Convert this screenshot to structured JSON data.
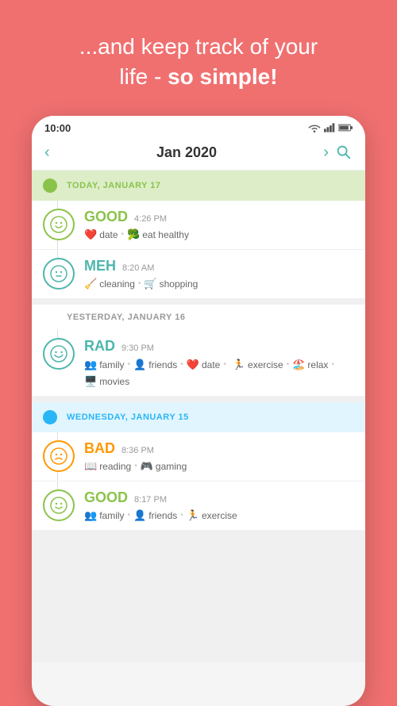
{
  "header": {
    "line1": "...and keep track of your",
    "line2_plain": "life - ",
    "line2_bold": "so simple!"
  },
  "statusBar": {
    "time": "10:00",
    "icons": [
      "wifi",
      "signal",
      "battery"
    ]
  },
  "nav": {
    "title": "Jan 2020",
    "leftArrow": "‹",
    "rightArrow": "›",
    "searchIcon": "search"
  },
  "days": [
    {
      "id": "today",
      "type": "today",
      "label": "TODAY, JANUARY 17",
      "dotColor": "green",
      "entries": [
        {
          "mood": "GOOD",
          "moodColor": "green",
          "time": "4:26 PM",
          "face": "😊",
          "tags": [
            {
              "icon": "❤️",
              "label": "date"
            },
            {
              "icon": "🥦",
              "label": "eat healthy"
            }
          ]
        },
        {
          "mood": "MEH",
          "moodColor": "teal",
          "time": "8:20 AM",
          "face": "😑",
          "tags": [
            {
              "icon": "🧹",
              "label": "cleaning"
            },
            {
              "icon": "🛒",
              "label": "shopping"
            }
          ]
        }
      ]
    },
    {
      "id": "yesterday",
      "type": "yesterday",
      "label": "YESTERDAY, JANUARY 16",
      "dotColor": "none",
      "entries": [
        {
          "mood": "RAD",
          "moodColor": "teal",
          "time": "9:30 PM",
          "face": "😁",
          "tags": [
            {
              "icon": "👥",
              "label": "family"
            },
            {
              "icon": "👤",
              "label": "friends"
            },
            {
              "icon": "❤️",
              "label": "date"
            },
            {
              "icon": "🏃",
              "label": "exercise"
            },
            {
              "icon": "🏖️",
              "label": "relax"
            },
            {
              "icon": "🖥️",
              "label": "movies"
            }
          ]
        }
      ]
    },
    {
      "id": "wednesday",
      "type": "wednesday",
      "label": "WEDNESDAY, JANUARY 15",
      "dotColor": "blue",
      "entries": [
        {
          "mood": "BAD",
          "moodColor": "orange",
          "time": "8:36 PM",
          "face": "😟",
          "tags": [
            {
              "icon": "📖",
              "label": "reading"
            },
            {
              "icon": "🎮",
              "label": "gaming"
            }
          ]
        },
        {
          "mood": "GOOD",
          "moodColor": "green",
          "time": "8:17 PM",
          "face": "😊",
          "tags": [
            {
              "icon": "👥",
              "label": "family"
            },
            {
              "icon": "👤",
              "label": "friends"
            },
            {
              "icon": "🏃",
              "label": "exercise"
            }
          ]
        }
      ]
    }
  ]
}
